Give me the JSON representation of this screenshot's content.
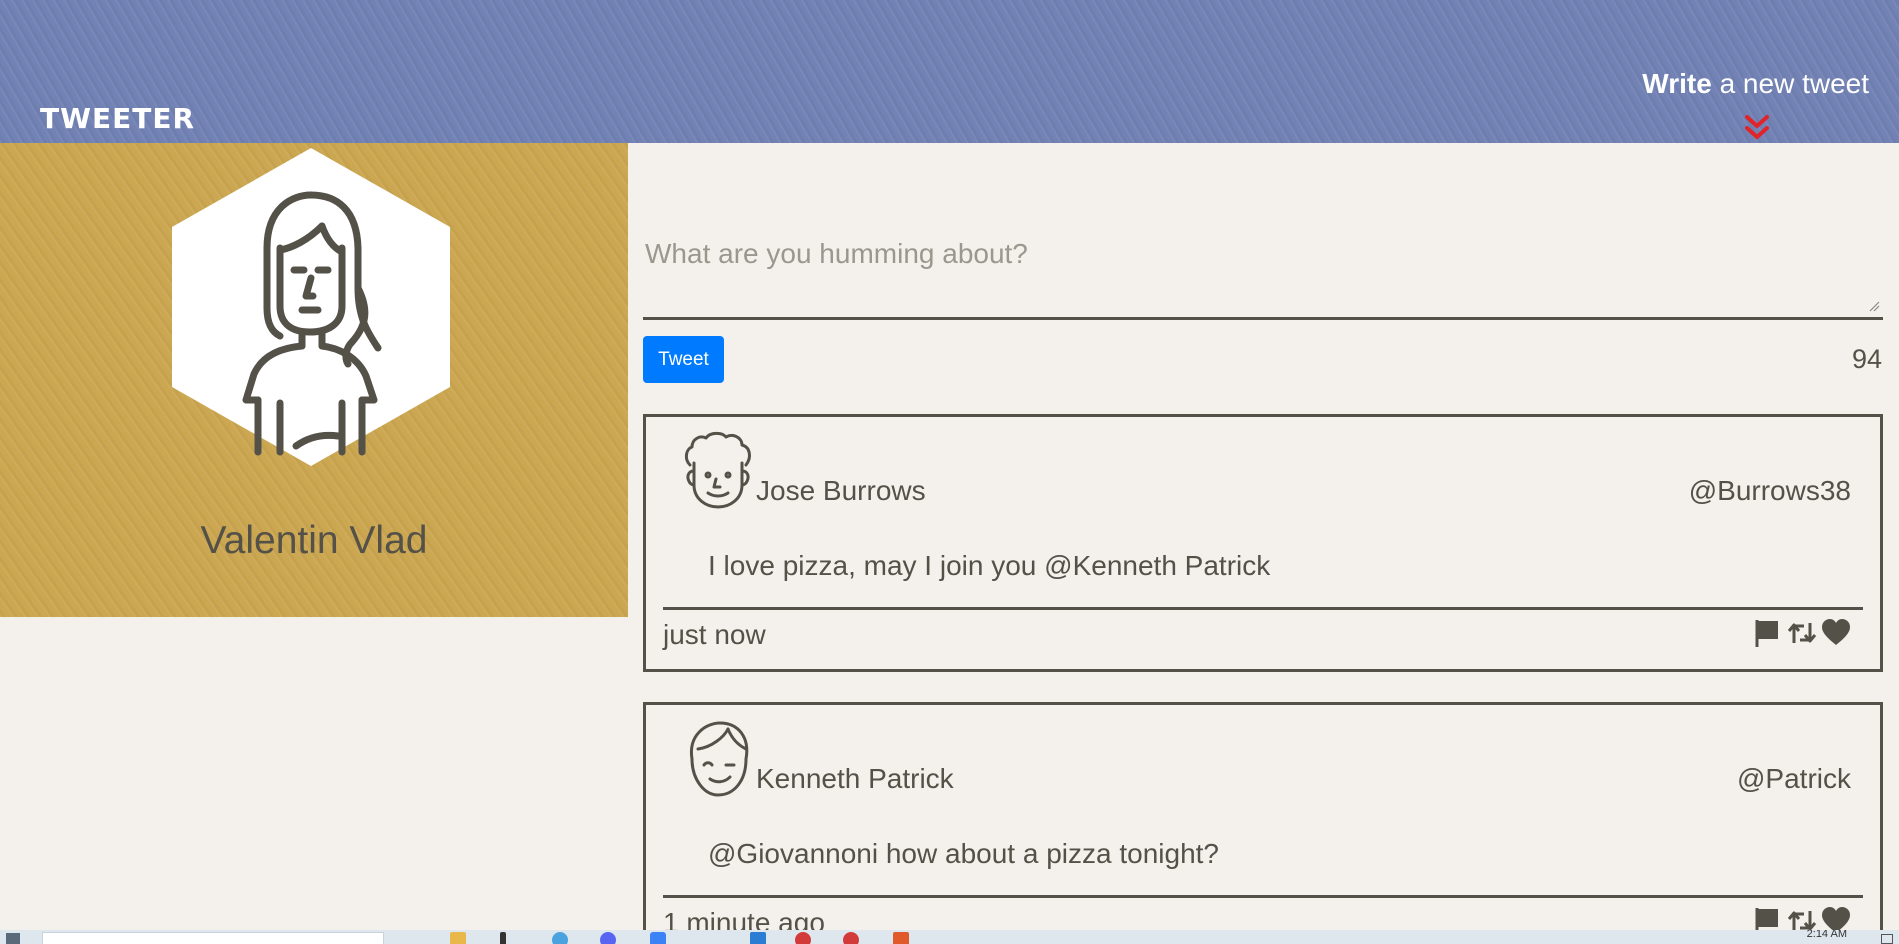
{
  "header": {
    "brand": "TWEETER",
    "compose_toggle_bold": "Write",
    "compose_toggle_rest": " a new tweet",
    "colors": {
      "background": "#7282b4",
      "chevron": "#e0242a"
    }
  },
  "profile": {
    "name": "Valentin Vlad",
    "avatar_icon": "female-avatar-icon",
    "colors": {
      "background": "#cca751"
    }
  },
  "compose": {
    "placeholder": "What are you humming about?",
    "value": "",
    "button_label": "Tweet",
    "char_counter": "94"
  },
  "tweets": [
    {
      "author": "Jose Burrows",
      "handle": "@Burrows38",
      "body": "I love pizza, may I join you @Kenneth Patrick",
      "time": "just now",
      "avatar_icon": "curly-hair-man-avatar-icon"
    },
    {
      "author": "Kenneth Patrick",
      "handle": "@Patrick",
      "body": "@Giovannoni how about a pizza tonight?",
      "time": "1 minute ago",
      "avatar_icon": "winking-boy-avatar-icon"
    }
  ],
  "tweet_actions": [
    "flag-icon",
    "retweet-icon",
    "heart-icon"
  ],
  "taskbar": {
    "clock": "2:14 AM"
  },
  "theme": {
    "page_background": "#f4f1ec",
    "text": "#545149",
    "button": "#007bff"
  }
}
